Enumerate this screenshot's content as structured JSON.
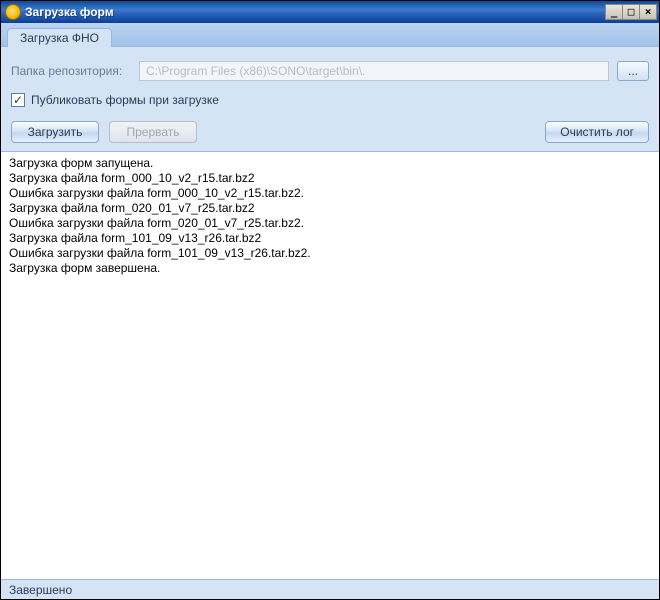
{
  "window": {
    "title": "Загрузка форм",
    "min_btn": "_",
    "max_btn": "□",
    "close_btn": "×"
  },
  "tabs": [
    {
      "label": "Загрузка ФНО"
    }
  ],
  "repo": {
    "label": "Папка репозитория:",
    "path": "C:\\Program Files (x86)\\SONO\\target\\bin\\.",
    "browse_label": "..."
  },
  "publish": {
    "label": "Публиковать формы при загрузке",
    "checked": true,
    "checkmark": "✓"
  },
  "buttons": {
    "load": "Загрузить",
    "abort": "Прервать",
    "clear_log": "Очистить лог"
  },
  "log_lines": [
    "Загрузка форм запущена.",
    "Загрузка файла form_000_10_v2_r15.tar.bz2",
    "Ошибка загрузки файла form_000_10_v2_r15.tar.bz2.",
    "Загрузка файла form_020_01_v7_r25.tar.bz2",
    "Ошибка загрузки файла form_020_01_v7_r25.tar.bz2.",
    "Загрузка файла form_101_09_v13_r26.tar.bz2",
    "Ошибка загрузки файла form_101_09_v13_r26.tar.bz2.",
    "Загрузка форм завершена."
  ],
  "status": {
    "text": "Завершено"
  }
}
